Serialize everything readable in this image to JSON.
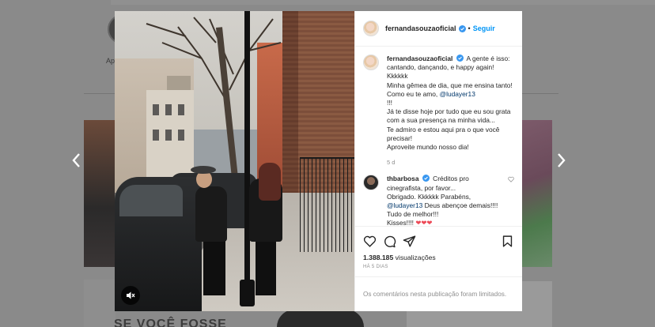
{
  "background": {
    "profile_label": "Ap",
    "caption_partial": "SE VOCÊ FOSSE"
  },
  "post": {
    "username": "fernandasouzaoficial",
    "follow_label": "Seguir",
    "separator": "•",
    "caption_lines": [
      "A gente é isso: cantando, dançando, e happy again! Kkkkkk",
      "Minha gêmea de dia, que me ensina tanto! Como eu te amo,",
      "@ludayer13",
      "!!!",
      "Já te disse hoje por tudo que eu sou grata com a sua presença na minha vida...",
      "Te admiro e estou aqui pra o que você precisar!",
      "Aproveite mundo nosso dia!"
    ],
    "caption_time": "5 d",
    "comment": {
      "username": "thbarbosa",
      "text_lines": [
        "Créditos pro cinegrafista, por favor...",
        "Obrigado. Kkkkkk Parabéns,",
        "@ludayer13",
        "Deus abençoe demais!!!! Tudo de melhor!!!",
        "Kisses!!!!"
      ],
      "hearts": "❤❤❤"
    },
    "views_count": "1.388.185",
    "views_label": "visualizações",
    "posted_ago": "HÁ 5 DIAS",
    "comments_disabled": "Os comentários nesta publicação foram limitados."
  },
  "icons": {
    "like": "heart-icon",
    "comment": "comment-icon",
    "share": "share-icon",
    "save": "bookmark-icon",
    "mute": "speaker-mute-icon",
    "prev": "chevron-left-icon",
    "next": "chevron-right-icon"
  },
  "colors": {
    "accent": "#0095f6",
    "verified": "#3897f0",
    "heart": "#ed4956",
    "muted_text": "#8e8e8e"
  }
}
